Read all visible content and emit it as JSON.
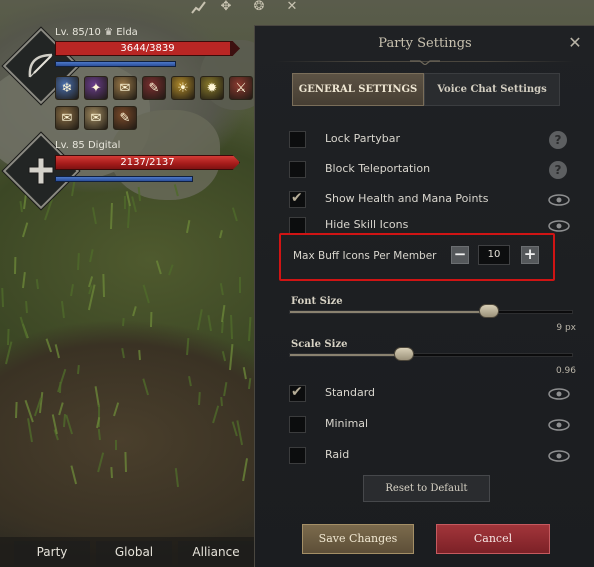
{
  "hud": {
    "top_icons": [
      "stats-icon",
      "party-menu-icon",
      "group-icon",
      "swords-icon"
    ],
    "members": [
      {
        "level": "Lv. 85/10",
        "name": "Elda",
        "hp_text": "3644/3839",
        "hp_fraction": 0.95,
        "mp_fraction": 0.72,
        "portrait_icon": "bow-class-icon",
        "buff_icons": [
          {
            "name": "ice-wolf-buff-icon",
            "glyph": "❄",
            "color": "#4a6fae"
          },
          {
            "name": "arcane-book-buff-icon",
            "glyph": "✦",
            "color": "#6a3e8c"
          },
          {
            "name": "scroll-buff-icon",
            "glyph": "✉",
            "color": "#9a7a4a"
          },
          {
            "name": "tome-buff-icon",
            "glyph": "✎",
            "color": "#7a2f2f"
          },
          {
            "name": "sun-buff-icon",
            "glyph": "☀",
            "color": "#b08a2a"
          },
          {
            "name": "gold-emblem-buff-icon",
            "glyph": "✹",
            "color": "#8a7a2a"
          },
          {
            "name": "sword-buff-icon",
            "glyph": "⚔",
            "color": "#8c3a2f"
          },
          {
            "name": "recipe-buff-icon",
            "glyph": "✎",
            "color": "#6a4e2f"
          },
          {
            "name": "letter-buff-icon",
            "glyph": "✉",
            "color": "#8a6e45"
          },
          {
            "name": "parchment-buff-icon",
            "glyph": "✉",
            "color": "#a08a60"
          },
          {
            "name": "book-buff-icon",
            "glyph": "✎",
            "color": "#7a4a2a"
          }
        ]
      },
      {
        "level": "Lv. 85",
        "name": "Digital",
        "hp_text": "2137/2137",
        "hp_fraction": 1.0,
        "mp_fraction": 0.82,
        "portrait_icon": "holy-cross-class-icon"
      }
    ],
    "bottom_tabs": [
      "Party",
      "Global",
      "Alliance"
    ]
  },
  "panel": {
    "title": "Party Settings",
    "tabs": {
      "general": "GENERAL SETTINGS",
      "voice": "Voice Chat Settings"
    },
    "options": [
      {
        "label": "Lock Partybar",
        "checked": false,
        "trailing": "help-icon"
      },
      {
        "label": "Block Teleportation",
        "checked": false,
        "trailing": "help-icon"
      },
      {
        "label": "Show Health and Mana Points",
        "checked": true,
        "trailing": "eye-icon"
      },
      {
        "label": "Hide Skill Icons",
        "checked": false,
        "trailing": "eye-icon"
      }
    ],
    "max_buff": {
      "label": "Max Buff Icons Per Member",
      "value": "10",
      "minus": "−",
      "plus": "+"
    },
    "font_size": {
      "label": "Font Size",
      "value_text": "9 px",
      "fraction": 0.7
    },
    "scale_size": {
      "label": "Scale Size",
      "value_text": "0.96",
      "fraction": 0.4
    },
    "layouts": [
      {
        "label": "Standard",
        "checked": true
      },
      {
        "label": "Minimal",
        "checked": false
      },
      {
        "label": "Raid",
        "checked": false
      }
    ],
    "help_glyph": "?",
    "close_glyph": "✕",
    "reset_label": "Reset to Default",
    "save_label": "Save Changes",
    "cancel_label": "Cancel",
    "highlight_color": "#d01414"
  }
}
